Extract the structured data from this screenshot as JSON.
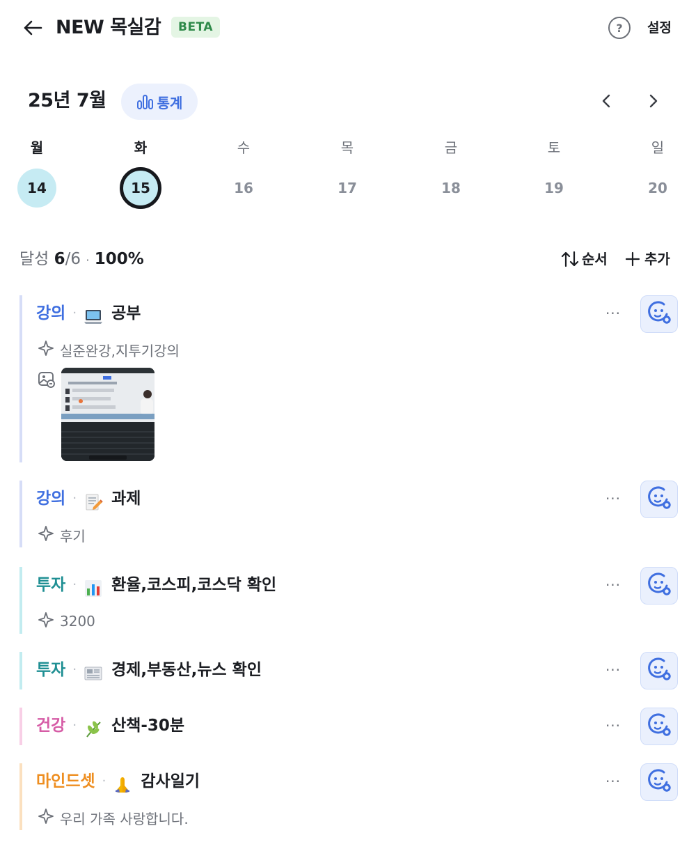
{
  "header": {
    "title": "NEW 목실감",
    "badge": "BETA",
    "help_icon_text": "?",
    "settings_label": "설정"
  },
  "calendar": {
    "month_label": "25년 7월",
    "stats_label": "통계",
    "days": [
      {
        "dow": "월",
        "date": "14",
        "state": "filled"
      },
      {
        "dow": "화",
        "date": "15",
        "state": "today"
      },
      {
        "dow": "수",
        "date": "16",
        "state": "none"
      },
      {
        "dow": "목",
        "date": "17",
        "state": "none"
      },
      {
        "dow": "금",
        "date": "18",
        "state": "none"
      },
      {
        "dow": "토",
        "date": "19",
        "state": "none"
      },
      {
        "dow": "일",
        "date": "20",
        "state": "none"
      }
    ]
  },
  "summary": {
    "label": "달성",
    "done": "6",
    "total": "/6",
    "dot": "·",
    "percent": "100%",
    "sort_label": "순서",
    "add_label": "추가"
  },
  "colors": {
    "lecture": "#3f6fe0",
    "invest": "#1f8f93",
    "health": "#d65ca6",
    "mindset": "#ee8e20",
    "accent": "#3f6fe0"
  },
  "items": [
    {
      "category": "강의",
      "emoji": "laptop-icon",
      "name": "공부",
      "memo": "실준완강,지투기강의",
      "has_photo": true
    },
    {
      "category": "강의",
      "emoji": "memo-icon",
      "name": "과제",
      "memo": "후기",
      "has_photo": false
    },
    {
      "category": "투자",
      "emoji": "bar-chart-icon",
      "name": "환율,코스피,코스닥 확인",
      "memo": "3200",
      "has_photo": false
    },
    {
      "category": "투자",
      "emoji": "newspaper-icon",
      "name": "경제,부동산,뉴스 확인",
      "memo": "",
      "has_photo": false
    },
    {
      "category": "건강",
      "emoji": "herb-icon",
      "name": "산책-30분",
      "memo": "",
      "has_photo": false
    },
    {
      "category": "마인드셋",
      "emoji": "praying-hands-icon",
      "name": "감사일기",
      "memo": "우리 가족 사랑합니다.",
      "has_photo": false
    }
  ],
  "item_more_label": "···"
}
